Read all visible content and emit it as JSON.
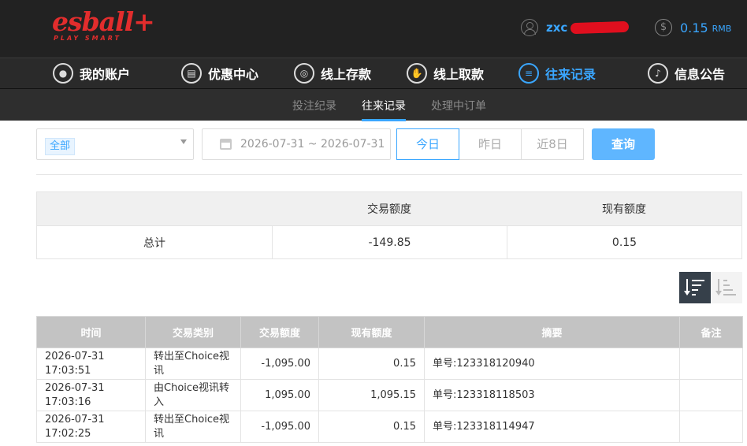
{
  "brand": {
    "logo_main": "esball+",
    "logo_sub": "PLAY SMART"
  },
  "account": {
    "username": "zxc",
    "balance": "0.15",
    "currency": "RMB",
    "user_icon": "user-circle-icon",
    "balance_icon": "dollar-coin-icon"
  },
  "nav": [
    {
      "label": "我的账户",
      "icon": "user-icon",
      "glyph": "●"
    },
    {
      "label": "优惠中心",
      "icon": "gift-icon",
      "glyph": "▤"
    },
    {
      "label": "线上存款",
      "icon": "deposit-icon",
      "glyph": "◎"
    },
    {
      "label": "线上取款",
      "icon": "withdraw-icon",
      "glyph": "✋"
    },
    {
      "label": "往来记录",
      "icon": "records-icon",
      "glyph": "≡",
      "active": true
    },
    {
      "label": "信息公告",
      "icon": "bell-icon",
      "glyph": "♪"
    }
  ],
  "subnav": [
    {
      "label": "投注纪录"
    },
    {
      "label": "往来记录",
      "active": true
    },
    {
      "label": "处理中订单"
    }
  ],
  "filters": {
    "type_selected": "全部",
    "date_range": "2026-07-31 ~ 2026-07-31",
    "quick_ranges": [
      "今日",
      "昨日",
      "近8日"
    ],
    "active_range": "今日",
    "query_label": "查询"
  },
  "summary": {
    "headers": [
      "",
      "交易额度",
      "现有额度"
    ],
    "row": {
      "label": "总计",
      "amount": "-149.85",
      "balance": "0.15"
    }
  },
  "sort": {
    "desc_icon": "sort-descending-icon",
    "asc_icon": "sort-ascending-icon",
    "active": "desc"
  },
  "table": {
    "headers": [
      "时间",
      "交易类别",
      "交易额度",
      "现有额度",
      "摘要",
      "备注"
    ],
    "rows": [
      {
        "time": "2026-07-31 17:03:51",
        "type": "转出至Choice视讯",
        "amount": "-1,095.00",
        "balance": "0.15",
        "summary": "单号:123318120940",
        "note": ""
      },
      {
        "time": "2026-07-31 17:03:16",
        "type": "由Choice视讯转入",
        "amount": "1,095.00",
        "balance": "1,095.15",
        "summary": "单号:123318118503",
        "note": ""
      },
      {
        "time": "2026-07-31 17:02:25",
        "type": "转出至Choice视讯",
        "amount": "-1,095.00",
        "balance": "0.15",
        "summary": "单号:123318114947",
        "note": ""
      }
    ]
  },
  "colors": {
    "accent": "#3aa6ff",
    "brand_red": "#e22d2d",
    "header_bg": "#222222",
    "nav_bg": "#2a2a2a",
    "table_head": "#c3c3c3",
    "sort_active": "#36404a"
  }
}
